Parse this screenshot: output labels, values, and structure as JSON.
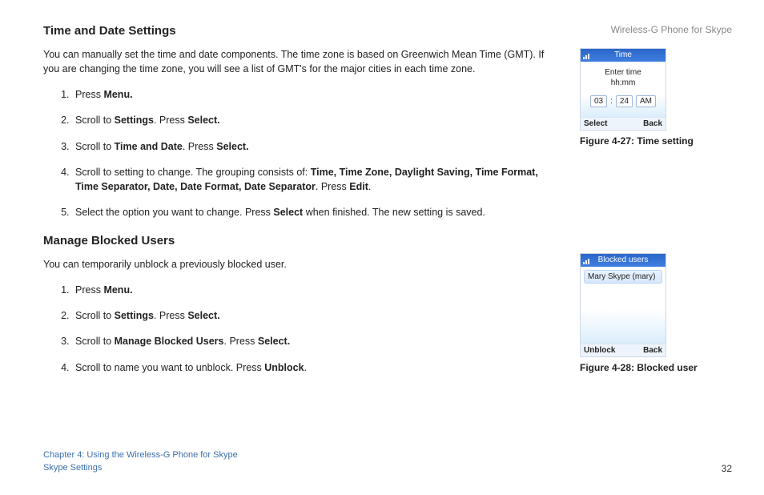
{
  "header": {
    "product": "Wireless-G Phone for Skype"
  },
  "section1": {
    "title": "Time and Date Settings",
    "intro": "You can manually set the time and date components. The time zone is based on Greenwich Mean Time (GMT). If you are changing the time zone, you will see a list of GMT's for the major cities in each time zone.",
    "steps": {
      "s1a": "Press ",
      "s1b": "Menu.",
      "s2a": "Scroll to ",
      "s2b": "Settings",
      "s2c": ". Press ",
      "s2d": "Select.",
      "s3a": "Scroll to ",
      "s3b": "Time and Date",
      "s3c": ". Press ",
      "s3d": "Select.",
      "s4a": "Scroll to setting to change. The grouping consists of: ",
      "s4b": "Time, Time Zone, Daylight Saving, Time Format, Time Separator, Date, Date Format, Date Separator",
      "s4c": ". Press ",
      "s4d": "Edit",
      "s4e": ".",
      "s5a": "Select the option you want to change. Press ",
      "s5b": "Select",
      "s5c": " when finished. The new setting is saved."
    }
  },
  "section2": {
    "title": "Manage Blocked Users",
    "intro": "You can temporarily unblock a previously blocked user.",
    "steps": {
      "s1a": "Press ",
      "s1b": "Menu.",
      "s2a": "Scroll to ",
      "s2b": "Settings",
      "s2c": ". Press ",
      "s2d": "Select.",
      "s3a": "Scroll to ",
      "s3b": "Manage Blocked Users",
      "s3c": ". Press ",
      "s3d": "Select.",
      "s4a": "Scroll to name you want to unblock. Press ",
      "s4b": "Unblock",
      "s4c": "."
    }
  },
  "fig1": {
    "titlebar": "Time",
    "line1": "Enter time",
    "line2": "hh:mm",
    "hh": "03",
    "colon": ":",
    "mm": "24",
    "ampm": "AM",
    "soft_left": "Select",
    "soft_right": "Back",
    "caption": "Figure 4-27: Time setting"
  },
  "fig2": {
    "titlebar": "Blocked users",
    "item": "Mary Skype (mary)",
    "soft_left": "Unblock",
    "soft_right": "Back",
    "caption": "Figure 4-28: Blocked user"
  },
  "footer": {
    "chapter": "Chapter 4: Using the Wireless-G Phone for Skype",
    "subsection": "Skype Settings",
    "page": "32"
  }
}
